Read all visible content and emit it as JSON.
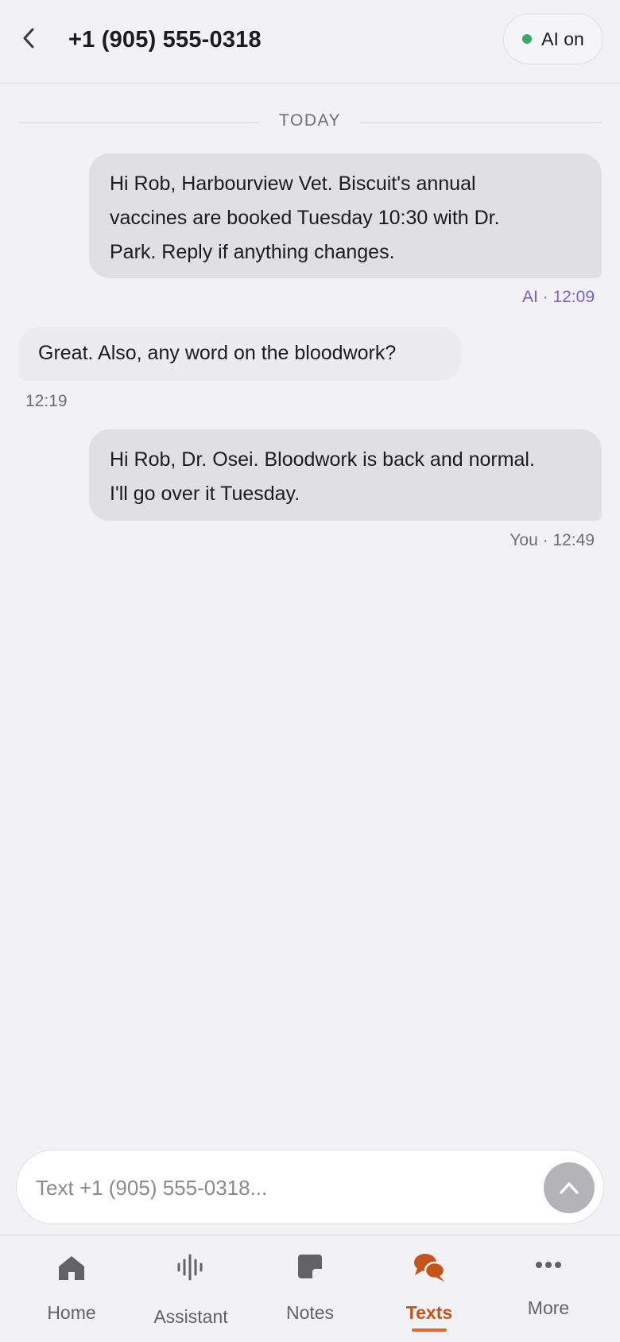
{
  "header": {
    "title": "+1 (905) 555-0318",
    "ai_status_label": "AI on",
    "ai_status_color": "#3aa76d"
  },
  "divider": {
    "label": "TODAY"
  },
  "messages": [
    {
      "direction": "outgoing",
      "lines": [
        "Hi Rob, Harbourview Vet. Biscuit's annual",
        "vaccines are booked Tuesday 10:30 with Dr.",
        "Park. Reply if anything changes."
      ],
      "meta": "AI · 12:09",
      "sender": "AI"
    },
    {
      "direction": "incoming",
      "lines": [
        "Great. Also, any word on the bloodwork?"
      ],
      "meta": "12:19"
    },
    {
      "direction": "outgoing",
      "lines": [
        "Hi Rob, Dr. Osei. Bloodwork is back and normal.",
        "I'll go over it Tuesday."
      ],
      "meta": "You · 12:49",
      "sender": "You"
    }
  ],
  "composer": {
    "placeholder": "Text +1 (905) 555-0318..."
  },
  "tabs": [
    {
      "label": "Home",
      "icon": "home-icon",
      "active": false
    },
    {
      "label": "Assistant",
      "icon": "waveform-icon",
      "active": false
    },
    {
      "label": "Notes",
      "icon": "note-icon",
      "active": false
    },
    {
      "label": "Texts",
      "icon": "chat-bubbles-icon",
      "active": true
    },
    {
      "label": "More",
      "icon": "more-dots-icon",
      "active": false
    }
  ],
  "colors": {
    "accent": "#c4531c",
    "ai_meta": "#7d5fc7",
    "bubble": "#e0e0e2"
  }
}
